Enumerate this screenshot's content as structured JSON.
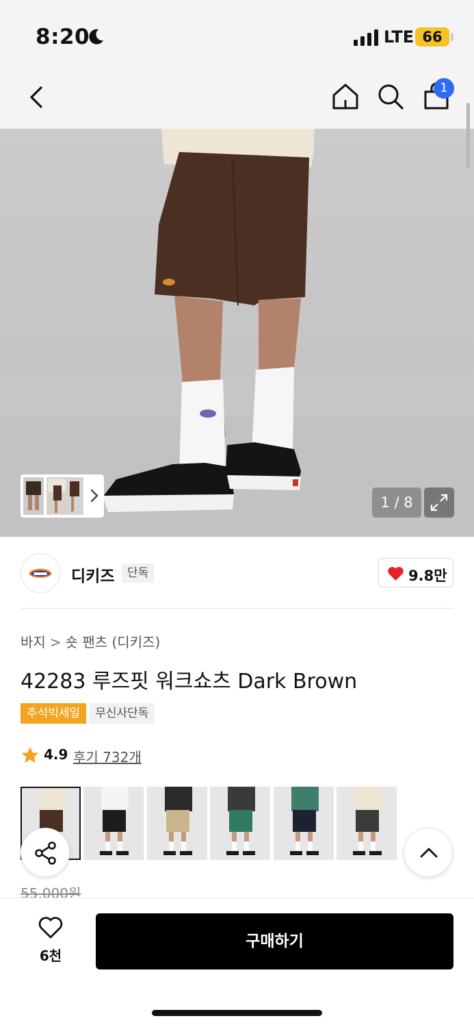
{
  "status_bar": {
    "time": "8:20",
    "network": "LTE",
    "battery": "66"
  },
  "header": {
    "cart_count": "1"
  },
  "gallery": {
    "counter": "1 / 8"
  },
  "brand": {
    "name": "디키즈",
    "exclusive_label": "단독",
    "likes": "9.8만"
  },
  "breadcrumb": {
    "category": "바지",
    "separator": ">",
    "subcategory": "숏 팬츠 (디키즈)"
  },
  "product": {
    "title": "42283 루즈핏 워크쇼츠 Dark Brown",
    "tags": [
      "추석빅세일",
      "무신사단독"
    ],
    "rating": "4.9",
    "reviews_label": "후기 732개",
    "original_price": "55,000원"
  },
  "color_options": [
    {
      "name": "dark-brown",
      "shirt": "#ede6d6",
      "shorts": "#4a2f22",
      "active": true
    },
    {
      "name": "black",
      "shirt": "#f4f4f4",
      "shorts": "#1c1c1c",
      "active": false
    },
    {
      "name": "khaki",
      "shirt": "#2a2a2a",
      "shorts": "#c9b48c",
      "active": false
    },
    {
      "name": "green",
      "shirt": "#3a3a3a",
      "shorts": "#2f7a64",
      "active": false
    },
    {
      "name": "navy",
      "shirt": "#3d7e6c",
      "shorts": "#1d2233",
      "active": false
    },
    {
      "name": "charcoal",
      "shirt": "#ede4d2",
      "shorts": "#3b3b3b",
      "active": false
    }
  ],
  "bottom_bar": {
    "wishlist_count": "6천",
    "buy_label": "구매하기"
  },
  "colors": {
    "badge_blue": "#2f6bf3",
    "sale_orange": "#f6a31f",
    "heart_red": "#e8202c",
    "star": "#f6a31f"
  }
}
